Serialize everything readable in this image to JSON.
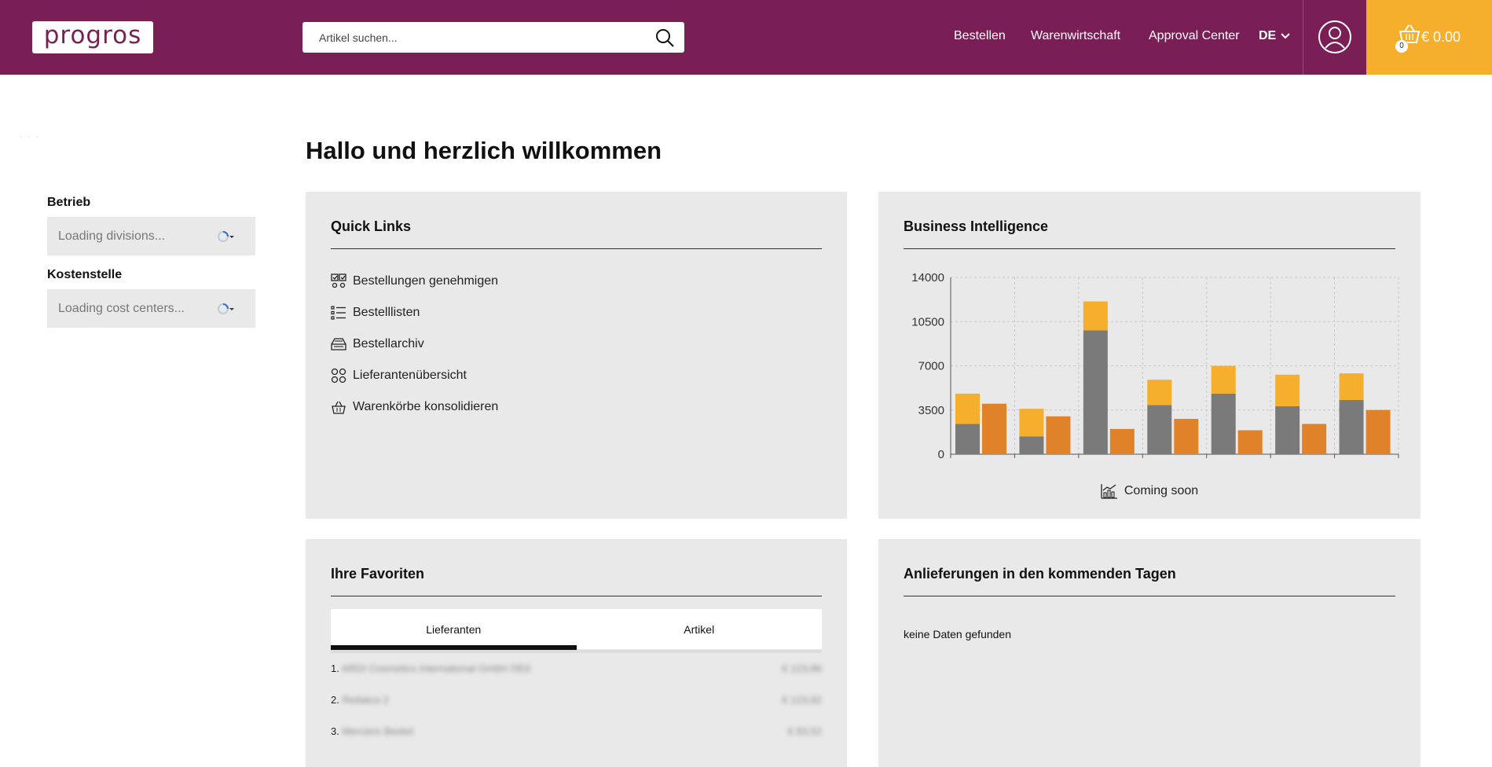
{
  "header": {
    "logo_text": "progros",
    "search_placeholder": "Artikel suchen...",
    "nav": [
      "Bestellen",
      "Warenwirtschaft",
      "Approval Center"
    ],
    "language": "DE",
    "cart_count": "0",
    "cart_total": "€ 0.00",
    "brand_color": "#7a1f55",
    "cart_color": "#f6ae2d"
  },
  "sidebar": {
    "betrieb_label": "Betrieb",
    "betrieb_value": "Loading divisions...",
    "kostenstelle_label": "Kostenstelle",
    "kostenstelle_value": "Loading cost centers..."
  },
  "main": {
    "title": "Hallo und herzlich willkommen"
  },
  "quick_links": {
    "title": "Quick Links",
    "items": [
      {
        "label": "Bestellungen genehmigen",
        "icon": "approve-icon"
      },
      {
        "label": "Bestelllisten",
        "icon": "list-icon"
      },
      {
        "label": "Bestellarchiv",
        "icon": "archive-icon"
      },
      {
        "label": "Lieferantenübersicht",
        "icon": "suppliers-icon"
      },
      {
        "label": "Warenkörbe konsolidieren",
        "icon": "basket-icon"
      }
    ]
  },
  "bi": {
    "title": "Business Intelligence",
    "coming_soon": "Coming soon"
  },
  "chart_data": {
    "type": "bar",
    "title": "",
    "ylim": [
      0,
      14000
    ],
    "yticks": [
      0,
      3500,
      7000,
      10500,
      14000
    ],
    "grid": true,
    "colors": {
      "gray": "#7a7a7a",
      "yellow": "#f6ae2d",
      "orange": "#e0822a"
    },
    "groups": [
      {
        "stack_gray": 2400,
        "stack_yellow": 2400,
        "orange": 4000
      },
      {
        "stack_gray": 1400,
        "stack_yellow": 2200,
        "orange": 3000
      },
      {
        "stack_gray": 9800,
        "stack_yellow": 2300,
        "orange": 2000
      },
      {
        "stack_gray": 3900,
        "stack_yellow": 2000,
        "orange": 2800
      },
      {
        "stack_gray": 4800,
        "stack_yellow": 2200,
        "orange": 1900
      },
      {
        "stack_gray": 3800,
        "stack_yellow": 2500,
        "orange": 2400
      },
      {
        "stack_gray": 4300,
        "stack_yellow": 2100,
        "orange": 3500
      }
    ]
  },
  "favorites": {
    "title": "Ihre Favoriten",
    "tabs": [
      "Lieferanten",
      "Artikel"
    ],
    "rows": [
      {
        "rank": "1.",
        "name": "ARDI Cosmetics International GmbH DE6",
        "value": "€ 123,86"
      },
      {
        "rank": "2.",
        "name": "Redatca 2",
        "value": "€ 123,92"
      },
      {
        "rank": "3.",
        "name": "Merciers Beekd",
        "value": "€ 83,52"
      }
    ]
  },
  "deliveries": {
    "title": "Anlieferungen in den kommenden Tagen",
    "empty": "keine Daten gefunden"
  }
}
